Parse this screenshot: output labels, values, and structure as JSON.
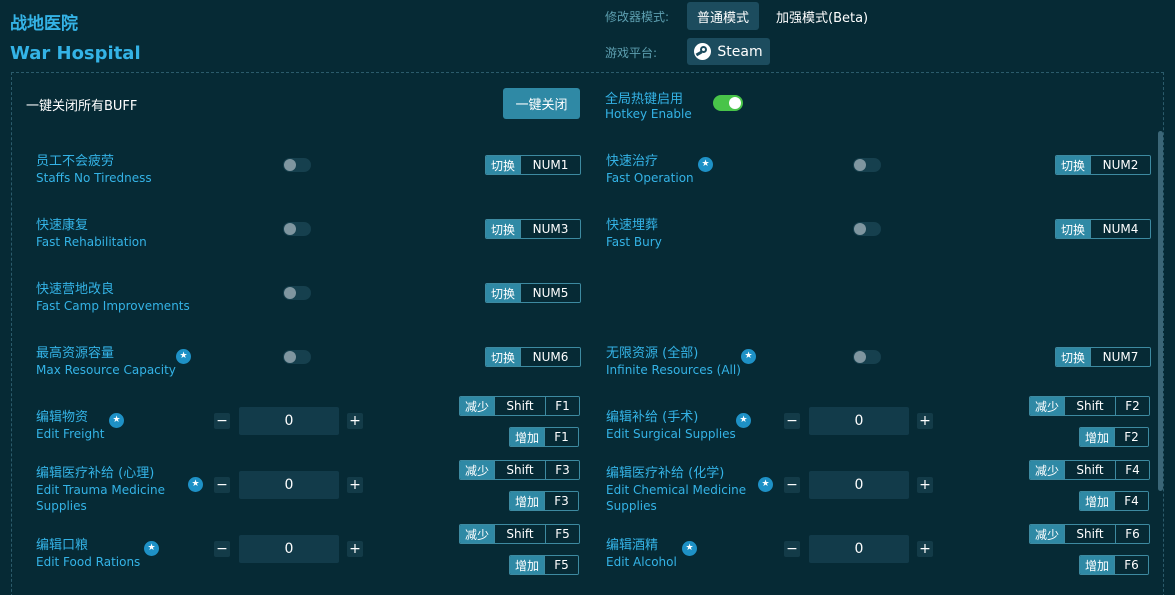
{
  "app": {
    "title_cn": "战地医院",
    "title_en": "War Hospital"
  },
  "mode": {
    "label": "修改器模式:",
    "normal": "普通模式",
    "enhanced": "加强模式(Beta)"
  },
  "platform": {
    "label": "游戏平台:",
    "steam": "Steam"
  },
  "buff": {
    "label": "一键关闭所有BUFF",
    "close_all": "一键关闭"
  },
  "hotkey": {
    "label_cn": "全局热键启用",
    "label_en": "Hotkey Enable",
    "enabled": true
  },
  "colors": {
    "accent": "#34b3e6",
    "background": "#062a35",
    "button": "#2f89a5",
    "toggle_on": "#48c449"
  },
  "key_labels": {
    "toggle": "切换",
    "decrease": "减少",
    "increase": "增加"
  },
  "toggles": [
    {
      "cn": "员工不会疲劳",
      "en": "Staffs No Tiredness",
      "key": "NUM1",
      "star": false
    },
    {
      "cn": "快速治疗",
      "en": "Fast Operation",
      "key": "NUM2",
      "star": true
    },
    {
      "cn": "快速康复",
      "en": "Fast Rehabilitation",
      "key": "NUM3",
      "star": false
    },
    {
      "cn": "快速埋葬",
      "en": "Fast Bury",
      "key": "NUM4",
      "star": false
    },
    {
      "cn": "快速营地改良",
      "en": "Fast Camp Improvements",
      "key": "NUM5",
      "star": false
    },
    {
      "cn": "最高资源容量",
      "en": "Max Resource Capacity",
      "key": "NUM6",
      "star": true
    },
    {
      "cn": "无限资源 (全部)",
      "en": "Infinite Resources (All)",
      "key": "NUM7",
      "star": true
    }
  ],
  "edits": [
    {
      "cn": "编辑物资",
      "en": "Edit Freight",
      "value": "0",
      "dec_mod": "Shift",
      "dec_key": "F1",
      "inc_key": "F1"
    },
    {
      "cn": "编辑补给 (手术)",
      "en": "Edit Surgical Supplies",
      "value": "0",
      "dec_mod": "Shift",
      "dec_key": "F2",
      "inc_key": "F2"
    },
    {
      "cn": "编辑医疗补给 (心理)",
      "en": "Edit Trauma Medicine Supplies",
      "value": "0",
      "dec_mod": "Shift",
      "dec_key": "F3",
      "inc_key": "F3"
    },
    {
      "cn": "编辑医疗补给 (化学)",
      "en": "Edit Chemical Medicine Supplies",
      "value": "0",
      "dec_mod": "Shift",
      "dec_key": "F4",
      "inc_key": "F4"
    },
    {
      "cn": "编辑口粮",
      "en": "Edit Food Rations",
      "value": "0",
      "dec_mod": "Shift",
      "dec_key": "F5",
      "inc_key": "F5"
    },
    {
      "cn": "编辑酒精",
      "en": "Edit Alcohol",
      "value": "0",
      "dec_mod": "Shift",
      "dec_key": "F6",
      "inc_key": "F6"
    }
  ],
  "stepper": {
    "minus": "−",
    "plus": "+"
  },
  "icons": {
    "star": "★",
    "steam": "steam-icon"
  }
}
